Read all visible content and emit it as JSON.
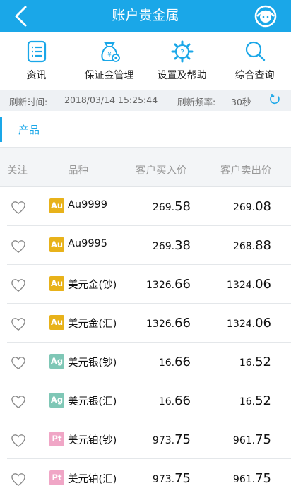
{
  "header": {
    "title": "账户贵金属"
  },
  "menu": [
    {
      "label": "资讯",
      "icon": "news-icon"
    },
    {
      "label": "保证金管理",
      "icon": "money-bag-icon"
    },
    {
      "label": "设置及帮助",
      "icon": "settings-help-icon"
    },
    {
      "label": "综合查询",
      "icon": "search-icon"
    }
  ],
  "refresh": {
    "time_label": "刷新时间:",
    "time_value": "2018/03/14 15:25:44",
    "freq_label": "刷新频率:",
    "freq_value": "30秒"
  },
  "tab": {
    "label": "产品"
  },
  "table": {
    "headers": [
      "关注",
      "品种",
      "客户买入价",
      "客户卖出价"
    ],
    "rows": [
      {
        "badge": "Au",
        "badge_color": "#e8b21a",
        "name": "Au9999",
        "buy_int": "269.",
        "buy_dec": "58",
        "sell_int": "269.",
        "sell_dec": "08"
      },
      {
        "badge": "Au",
        "badge_color": "#e8b21a",
        "name": "Au9995",
        "buy_int": "269.",
        "buy_dec": "38",
        "sell_int": "268.",
        "sell_dec": "88"
      },
      {
        "badge": "Au",
        "badge_color": "#e8b21a",
        "name": "美元金(钞)",
        "buy_int": "1326.",
        "buy_dec": "66",
        "sell_int": "1324.",
        "sell_dec": "06"
      },
      {
        "badge": "Au",
        "badge_color": "#e8b21a",
        "name": "美元金(汇)",
        "buy_int": "1326.",
        "buy_dec": "66",
        "sell_int": "1324.",
        "sell_dec": "06"
      },
      {
        "badge": "Ag",
        "badge_color": "#7fc7b6",
        "name": "美元银(钞)",
        "buy_int": "16.",
        "buy_dec": "66",
        "sell_int": "16.",
        "sell_dec": "52"
      },
      {
        "badge": "Ag",
        "badge_color": "#7fc7b6",
        "name": "美元银(汇)",
        "buy_int": "16.",
        "buy_dec": "66",
        "sell_int": "16.",
        "sell_dec": "52"
      },
      {
        "badge": "Pt",
        "badge_color": "#f0a6c6",
        "name": "美元铂(钞)",
        "buy_int": "973.",
        "buy_dec": "75",
        "sell_int": "961.",
        "sell_dec": "75"
      },
      {
        "badge": "Pt",
        "badge_color": "#f0a6c6",
        "name": "美元铂(汇)",
        "buy_int": "973.",
        "buy_dec": "75",
        "sell_int": "961.",
        "sell_dec": "75"
      }
    ]
  },
  "colors": {
    "primary": "#1aa7e8",
    "gold": "#e8b21a",
    "silver": "#7fc7b6",
    "platinum": "#f0a6c6"
  }
}
